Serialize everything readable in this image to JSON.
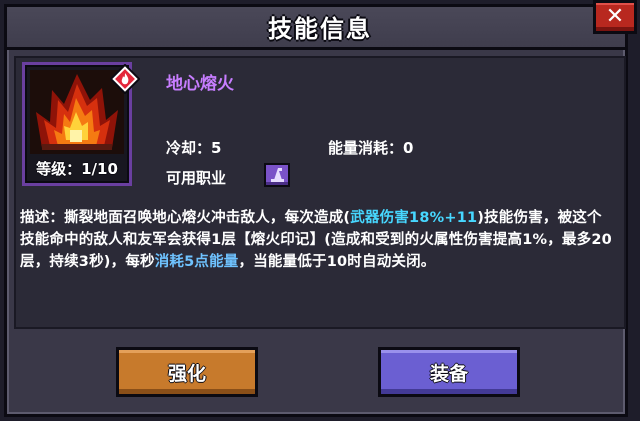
{
  "dialog": {
    "title": "技能信息",
    "close_label": "✕"
  },
  "skill": {
    "name": "地心熔火",
    "level": "等级：1/10",
    "cooldown": "冷却：5",
    "energy_cost": "能量消耗：0",
    "usable_class_label": "可用职业",
    "icon": "fire-skill-icon",
    "element_badge": "fire-element-icon",
    "class_icon": "wizard-hat-icon"
  },
  "description": {
    "part1": "描述：撕裂地面召唤地心熔火冲击敌人，每次造成(",
    "highlight1": "武器伤害18%+11",
    "part2": ")技能伤害，被这个技能命中的敌人和友军会获得1层【熔火印记】(造成和受到的火属性伤害提高1%，最多20层，持续3秒)，每秒",
    "highlight2": "消耗5点能量",
    "part3": "，当能量低于10时自动关闭。"
  },
  "buttons": {
    "strengthen": "强化",
    "equip": "装备"
  },
  "colors": {
    "skill_name": "#c77dff",
    "highlight": "#47d7ff",
    "strengthen_button": "#c77a2c",
    "equip_button": "#6b5fd2",
    "close_button": "#b8281f"
  }
}
